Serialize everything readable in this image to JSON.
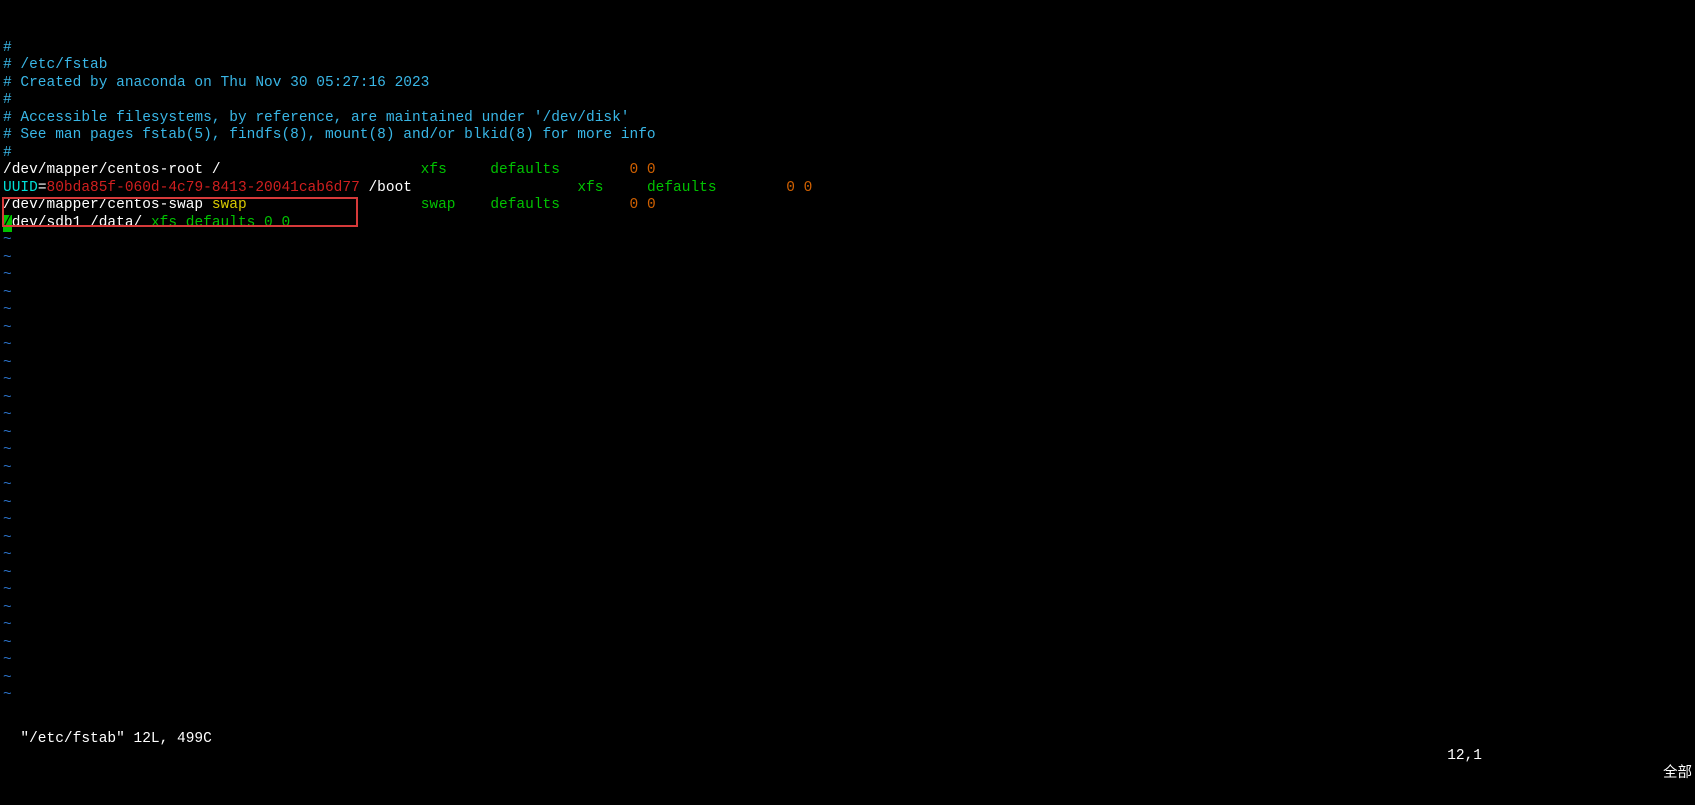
{
  "comments": {
    "l1": "#",
    "l2": "# /etc/fstab",
    "l3": "# Created by anaconda on Thu Nov 30 05:27:16 2023",
    "l4": "#",
    "l5": "# Accessible filesystems, by reference, are maintained under '/dev/disk'",
    "l6": "# See man pages fstab(5), findfs(8), mount(8) and/or blkid(8) for more info",
    "l7": "#"
  },
  "row1": {
    "dev": "/dev/mapper/centos-root /                       ",
    "fs": "xfs     ",
    "opt": "defaults        ",
    "dump": "0 0"
  },
  "row2": {
    "label": "UUID",
    "eq": "=",
    "uuid": "80bda85f-060d-4c79-8413-20041cab6d77",
    "mount": " /boot                   ",
    "fs": "xfs     ",
    "opt": "defaults        ",
    "dump": "0 0"
  },
  "row3": {
    "dev": "/dev/mapper/centos-swap ",
    "mount": "swap                    ",
    "fs": "swap    ",
    "opt": "defaults        ",
    "dump": "0 0"
  },
  "row4": {
    "cursor": "/",
    "rest": "dev/sdb1 /data/ ",
    "tail": "xfs defaults 0 0"
  },
  "tilde": "~",
  "status": {
    "file": "\"/etc/fstab\" 12L, 499C",
    "pos": "12,1",
    "mode": "全部"
  }
}
